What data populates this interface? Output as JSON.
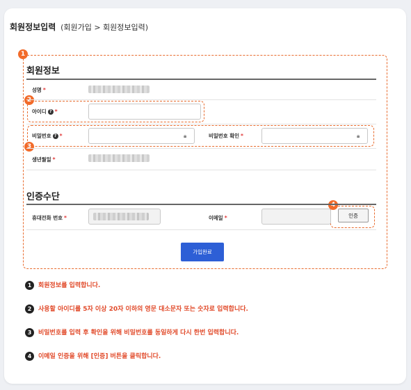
{
  "header": {
    "title": "회원정보입력",
    "breadcrumb": "(회원가입 > 회원정보입력)"
  },
  "badges": [
    "1",
    "2",
    "3",
    "4"
  ],
  "member_info": {
    "section_title": "회원정보",
    "name_label": "성명",
    "id_label": "아이디",
    "password_label": "비밀번호",
    "password_confirm_label": "비밀번호 확인",
    "birth_label": "생년월일",
    "required_mark": "*",
    "help_glyph": "?"
  },
  "verification": {
    "section_title": "인증수단",
    "phone_label": "휴대전화 번호",
    "email_label": "이메일",
    "verify_button": "인증"
  },
  "submit_button": "가입완료",
  "instructions": [
    {
      "num": "1",
      "text": "회원정보를 입력합니다."
    },
    {
      "num": "2",
      "text": "사용할 아이디를 5자 이상 20자 이하의 영문 대소문자 또는 숫자로 입력합니다."
    },
    {
      "num": "3",
      "text": "비밀번호를 입력 후 확인을 위해 비밀번호를 동일하게 다시 한번 입력합니다."
    },
    {
      "num": "4",
      "text": "이메일 인증을 위해 [인증] 버튼을 클릭합니다."
    }
  ],
  "colors": {
    "accent": "#e86a2c",
    "button": "#2d5fd6",
    "instruction_text": "#e14a2a",
    "required": "#e23b3b"
  }
}
